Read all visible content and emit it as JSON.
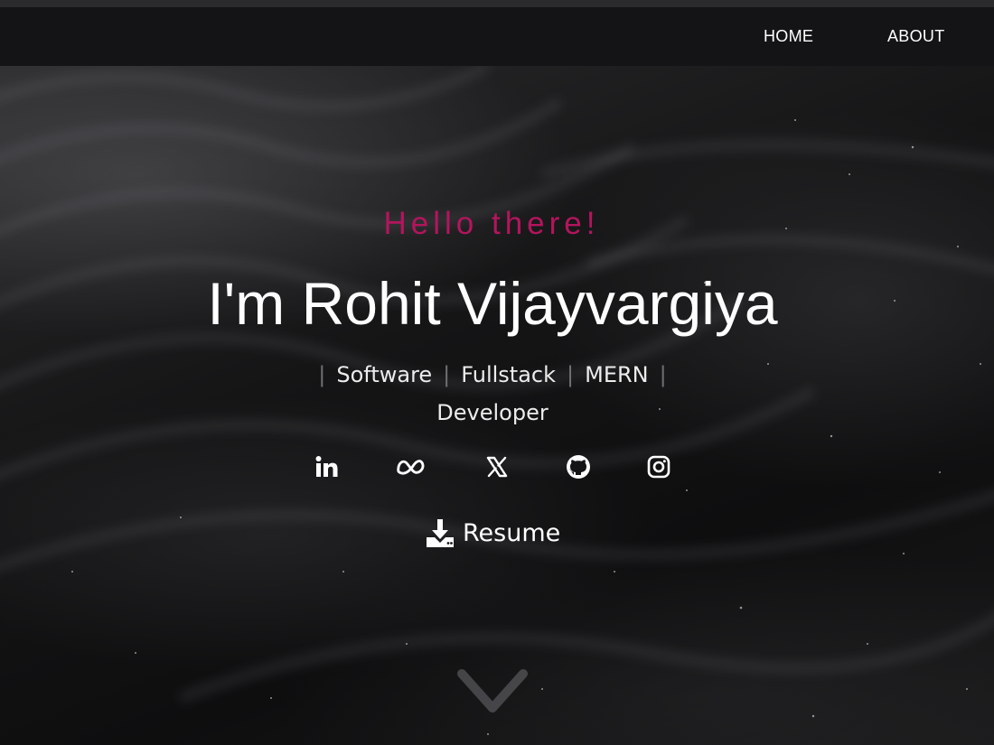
{
  "nav": {
    "home_label": "HOME",
    "about_label": "ABOUT"
  },
  "hero": {
    "greeting": "Hello there!",
    "name": "I'm Rohit Vijayvargiya",
    "roles": [
      "Software",
      "Fullstack",
      "MERN"
    ],
    "role_suffix": "Developer",
    "accent_color": "#b3155d"
  },
  "socials": [
    {
      "icon": "linkedin-icon"
    },
    {
      "icon": "meta-icon"
    },
    {
      "icon": "x-icon"
    },
    {
      "icon": "github-icon"
    },
    {
      "icon": "instagram-icon"
    }
  ],
  "resume": {
    "label": "Resume",
    "icon": "download-icon"
  },
  "scroll": {
    "icon": "chevron-down-icon"
  }
}
